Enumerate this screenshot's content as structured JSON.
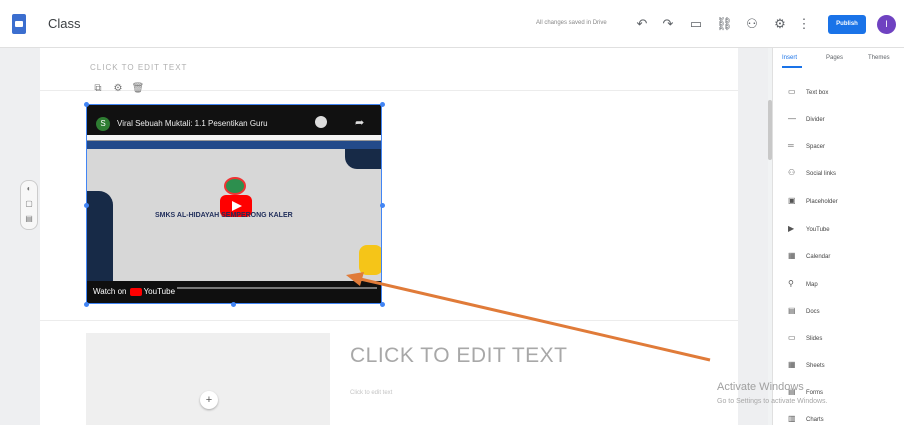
{
  "header": {
    "title": "Class",
    "save_status": "All changes saved in Drive",
    "publish_label": "Publish",
    "avatar_initial": "I",
    "icons": [
      "undo-icon",
      "redo-icon",
      "preview-icon",
      "link-icon",
      "share-user-icon",
      "settings-icon",
      "more-icon"
    ]
  },
  "section": {
    "header_text": "CLICK TO EDIT TEXT"
  },
  "video": {
    "title": "Viral Sebuah Muktali: 1.1 Pesentikan Guru",
    "channel_initial": "S",
    "school_name": "SMKS AL-HIDAYAH SEMPERONG KALER",
    "watch_on": "Watch on",
    "youtube": "YouTube"
  },
  "text_block": {
    "title": "CLICK TO EDIT TEXT",
    "subtitle": "Click to edit text"
  },
  "panel": {
    "tabs": [
      "Insert",
      "Pages",
      "Themes"
    ],
    "items": [
      {
        "label": "Text box",
        "icon": "text-box-icon"
      },
      {
        "label": "Divider",
        "icon": "divider-icon"
      },
      {
        "label": "Spacer",
        "icon": "spacer-icon"
      },
      {
        "label": "Social links",
        "icon": "social-links-icon"
      },
      {
        "label": "Placeholder",
        "icon": "placeholder-icon"
      },
      {
        "label": "YouTube",
        "icon": "youtube-icon"
      },
      {
        "label": "Calendar",
        "icon": "calendar-icon"
      },
      {
        "label": "Map",
        "icon": "map-icon"
      },
      {
        "label": "Docs",
        "icon": "docs-icon"
      },
      {
        "label": "Slides",
        "icon": "slides-icon"
      },
      {
        "label": "Sheets",
        "icon": "sheets-icon"
      },
      {
        "label": "Forms",
        "icon": "forms-icon"
      },
      {
        "label": "Charts",
        "icon": "charts-icon"
      }
    ]
  },
  "watermark": {
    "title": "Activate Windows",
    "subtitle": "Go to Settings to activate Windows."
  },
  "colors": {
    "accent": "#1a73e8",
    "annotation_arrow": "#e07b39",
    "youtube_red": "#ff0000"
  }
}
